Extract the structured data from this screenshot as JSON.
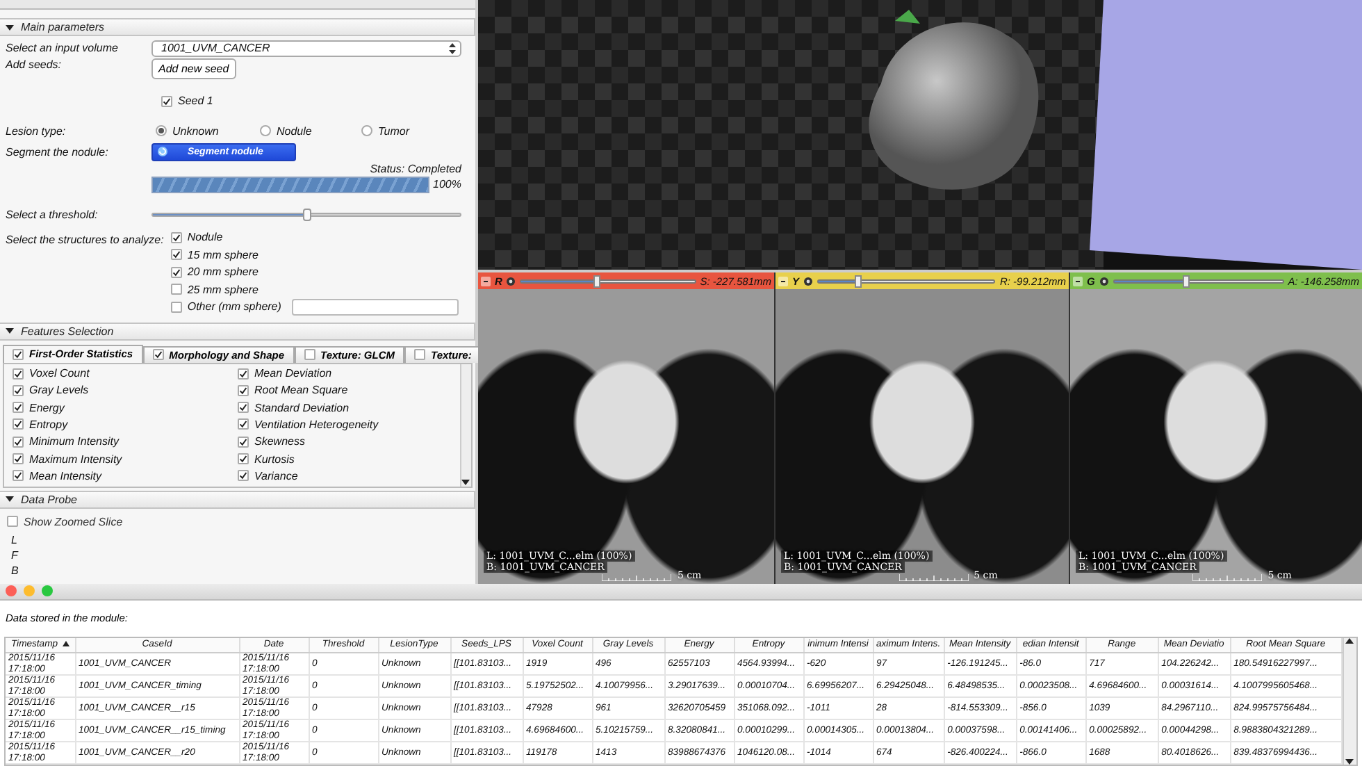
{
  "left_panel": {
    "main_parameters": {
      "title": "Main parameters",
      "expanded": true,
      "input_volume": {
        "label": "Select an input volume",
        "value": "1001_UVM_CANCER"
      },
      "add_seeds": {
        "label": "Add seeds:",
        "button": "Add new seed"
      },
      "seeds": [
        {
          "label": "Seed 1",
          "checked": true
        }
      ],
      "lesion_type": {
        "label": "Lesion type:",
        "options": [
          {
            "label": "Unknown",
            "selected": true
          },
          {
            "label": "Nodule",
            "selected": false
          },
          {
            "label": "Tumor",
            "selected": false
          }
        ]
      },
      "segment": {
        "label": "Segment the nodule:",
        "button": "Segment nodule",
        "status": "Status: Completed",
        "level": 1,
        "reading": "100%"
      },
      "threshold": {
        "label": "Select a threshold:",
        "level": 0.5
      },
      "structures": {
        "label": "Select the structures to analyze:",
        "items": [
          {
            "label": "Nodule",
            "checked": true,
            "kind": "plain"
          },
          {
            "label": "15 mm sphere",
            "checked": true,
            "kind": "plain"
          },
          {
            "label": "20 mm sphere",
            "checked": true,
            "kind": "plain"
          },
          {
            "label": "25 mm sphere",
            "checked": false,
            "kind": "plain"
          },
          {
            "label": "Other (mm sphere)",
            "checked": false,
            "kind": "with_field"
          }
        ]
      }
    },
    "features_selection": {
      "title": "Features Selection",
      "expanded": true,
      "tabs": [
        {
          "label": "First-Order Statistics",
          "checked": true,
          "selected": true
        },
        {
          "label": "Morphology and Shape",
          "checked": true,
          "selected": false
        },
        {
          "label": "Texture: GLCM",
          "checked": false,
          "selected": false
        },
        {
          "label": "Texture:",
          "checked": false,
          "selected": false
        }
      ],
      "features": [
        {
          "label": "Voxel Count",
          "checked": true
        },
        {
          "label": "Gray Levels",
          "checked": true
        },
        {
          "label": "Energy",
          "checked": true
        },
        {
          "label": "Entropy",
          "checked": true
        },
        {
          "label": "Minimum Intensity",
          "checked": true
        },
        {
          "label": "Maximum Intensity",
          "checked": true
        },
        {
          "label": "Mean Intensity",
          "checked": true
        },
        {
          "label": "Mean Deviation",
          "checked": true
        },
        {
          "label": "Root Mean Square",
          "checked": true
        },
        {
          "label": "Standard Deviation",
          "checked": true
        },
        {
          "label": "Ventilation Heterogeneity",
          "checked": true
        },
        {
          "label": "Skewness",
          "checked": true
        },
        {
          "label": "Kurtosis",
          "checked": true
        },
        {
          "label": "Variance",
          "checked": true
        }
      ]
    },
    "data_probe": {
      "title": "Data Probe",
      "expanded": true,
      "show_zoomed_slice": {
        "label": "Show Zoomed Slice",
        "checked": false
      },
      "lines": [
        "L",
        "F",
        "B"
      ]
    }
  },
  "slice_views": [
    {
      "letter": "R",
      "reading": "S: -227.581mm",
      "color": "#e8553f",
      "level": 0.43,
      "annotations": [
        "L: 1001_UVM_C...elm (100%)",
        "B: 1001_UVM_CANCER"
      ],
      "scale": "5 cm"
    },
    {
      "letter": "Y",
      "reading": "R: -99.212mm",
      "color": "#e8d04c",
      "level": 0.22,
      "annotations": [
        "L: 1001_UVM_C...elm (100%)",
        "B: 1001_UVM_CANCER"
      ],
      "scale": "5 cm"
    },
    {
      "letter": "G",
      "reading": "A: -146.258mm",
      "color": "#7fbf4d",
      "level": 0.42,
      "annotations": [
        "L: 1001_UVM_C...elm (100%)",
        "B: 1001_UVM_CANCER"
      ],
      "scale": "5 cm"
    }
  ],
  "data_window": {
    "caption": "Data stored in the module:",
    "table": {
      "columns": [
        {
          "label": "Timestamp",
          "sorted": true
        },
        {
          "label": "CaseId",
          "sorted": false
        },
        {
          "label": "Date",
          "sorted": false
        },
        {
          "label": "Threshold",
          "sorted": false
        },
        {
          "label": "LesionType",
          "sorted": false
        },
        {
          "label": "Seeds_LPS",
          "sorted": false
        },
        {
          "label": "Voxel Count",
          "sorted": false
        },
        {
          "label": "Gray Levels",
          "sorted": false
        },
        {
          "label": "Energy",
          "sorted": false
        },
        {
          "label": "Entropy",
          "sorted": false
        },
        {
          "label": "inimum Intensi",
          "sorted": false
        },
        {
          "label": "aximum Intens.",
          "sorted": false
        },
        {
          "label": "Mean Intensity",
          "sorted": false
        },
        {
          "label": "edian Intensit",
          "sorted": false
        },
        {
          "label": "Range",
          "sorted": false
        },
        {
          "label": "Mean Deviatio",
          "sorted": false
        },
        {
          "label": "Root Mean Square",
          "sorted": false
        }
      ],
      "rows": [
        [
          "2015/11/16 17:18:00",
          "1001_UVM_CANCER",
          "2015/11/16 17:18:00",
          "0",
          "Unknown",
          "[[101.83103...",
          "1919",
          "496",
          "62557103",
          "4564.93994...",
          "-620",
          "97",
          "-126.191245...",
          "-86.0",
          "717",
          "104.226242...",
          "180.54916227997..."
        ],
        [
          "2015/11/16 17:18:00",
          "1001_UVM_CANCER_timing",
          "2015/11/16 17:18:00",
          "0",
          "Unknown",
          "[[101.83103...",
          "5.19752502...",
          "4.10079956...",
          "3.29017639...",
          "0.00010704...",
          "6.69956207...",
          "6.29425048...",
          "6.48498535...",
          "0.00023508...",
          "4.69684600...",
          "0.00031614...",
          "4.1007995605468..."
        ],
        [
          "2015/11/16 17:18:00",
          "1001_UVM_CANCER__r15",
          "2015/11/16 17:18:00",
          "0",
          "Unknown",
          "[[101.83103...",
          "47928",
          "961",
          "32620705459",
          "351068.092...",
          "-1011",
          "28",
          "-814.553309...",
          "-856.0",
          "1039",
          "84.2967110...",
          "824.99575756484..."
        ],
        [
          "2015/11/16 17:18:00",
          "1001_UVM_CANCER__r15_timing",
          "2015/11/16 17:18:00",
          "0",
          "Unknown",
          "[[101.83103...",
          "4.69684600...",
          "5.10215759...",
          "8.32080841...",
          "0.00010299...",
          "0.00014305...",
          "0.00013804...",
          "0.00037598...",
          "0.00141406...",
          "0.00025892...",
          "0.00044298...",
          "8.9883804321289..."
        ],
        [
          "2015/11/16 17:18:00",
          "1001_UVM_CANCER__r20",
          "2015/11/16 17:18:00",
          "0",
          "Unknown",
          "[[101.83103...",
          "119178",
          "1413",
          "83988674376",
          "1046120.08...",
          "-1014",
          "674",
          "-826.400224...",
          "-866.0",
          "1688",
          "80.4018626...",
          "839.48376994436..."
        ]
      ]
    }
  }
}
